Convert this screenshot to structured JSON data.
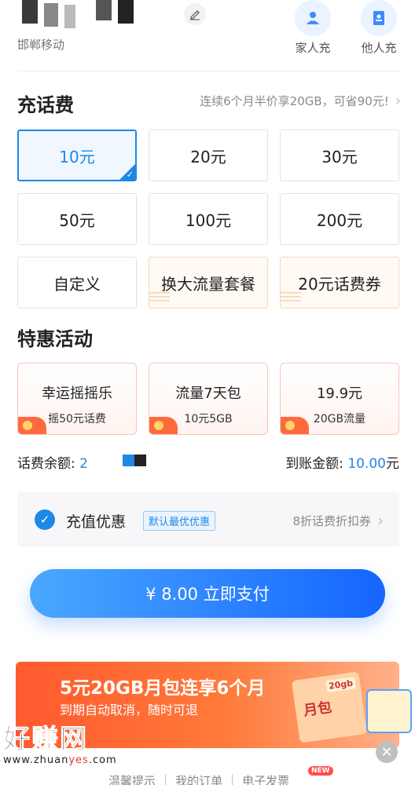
{
  "header": {
    "carrier": "邯郸移动",
    "family_topup": "家人充",
    "other_topup": "他人充"
  },
  "recharge": {
    "title": "充话费",
    "promo": "连续6个月半价享20GB，可省90元!",
    "amounts": [
      "10元",
      "20元",
      "30元",
      "50元",
      "100元",
      "200元",
      "自定义",
      "换大流量套餐",
      "20元话费券"
    ],
    "selected_index": 0
  },
  "activities": {
    "title": "特惠活动",
    "cards": [
      {
        "title": "幸运摇摇乐",
        "sub": "摇50元话费"
      },
      {
        "title": "流量7天包",
        "sub": "10元5GB"
      },
      {
        "title": "19.9元",
        "sub": "20GB流量"
      }
    ]
  },
  "balance": {
    "label": "话费余额:",
    "value": "2",
    "arrival_label": "到账金额:",
    "arrival_value": "10.00",
    "arrival_unit": "元"
  },
  "discount": {
    "label": "充值优惠",
    "badge": "默认最优优惠",
    "right": "8折话费折扣券"
  },
  "pay": {
    "label": "¥ 8.00  立即支付"
  },
  "banner": {
    "title": "5元20GB月包连享6个月",
    "subtitle": "到期自动取消，随时可退",
    "gift_tag": "20gb",
    "gift_text": "月包"
  },
  "watermark": {
    "big": "好赚网",
    "url_a": "www.zhuan",
    "url_b": "yes",
    "url_c": ".com"
  },
  "footer": {
    "tip": "温馨提示",
    "orders": "我的订单",
    "invoice": "电子发票",
    "new_tag": "NEW"
  },
  "colors": {
    "accent": "#1e88e5",
    "banner": "#ff5a2e"
  }
}
